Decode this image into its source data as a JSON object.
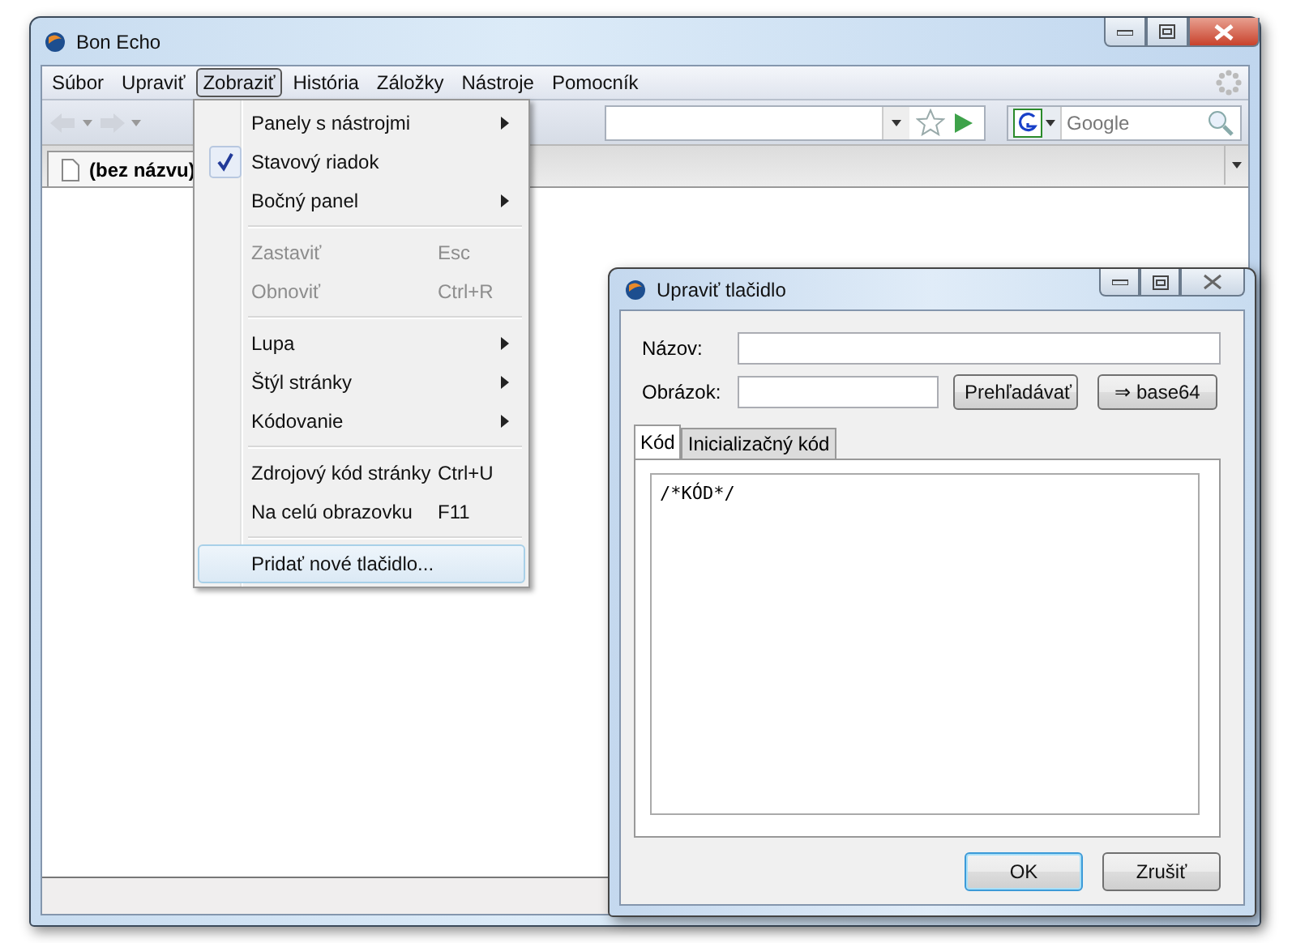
{
  "window": {
    "title": "Bon Echo"
  },
  "menubar": [
    {
      "label": "Súbor",
      "selected": false
    },
    {
      "label": "Upraviť",
      "selected": false
    },
    {
      "label": "Zobraziť",
      "selected": true
    },
    {
      "label": "História",
      "selected": false
    },
    {
      "label": "Záložky",
      "selected": false
    },
    {
      "label": "Nástroje",
      "selected": false
    },
    {
      "label": "Pomocník",
      "selected": false
    }
  ],
  "search": {
    "placeholder": "Google"
  },
  "tabs": [
    {
      "label": "(bez názvu)",
      "selected": true
    }
  ],
  "menu": [
    {
      "kind": "item",
      "label": "Panely s nástrojmi",
      "submenu": true,
      "checked": false,
      "disabled": false,
      "selected": false
    },
    {
      "kind": "item",
      "label": "Stavový riadok",
      "submenu": false,
      "checked": true,
      "disabled": false,
      "selected": false
    },
    {
      "kind": "item",
      "label": "Bočný panel",
      "submenu": true,
      "checked": false,
      "disabled": false,
      "selected": false
    },
    {
      "kind": "separator"
    },
    {
      "kind": "item",
      "label": "Zastaviť",
      "shortcut": "Esc",
      "submenu": false,
      "checked": false,
      "disabled": true,
      "selected": false
    },
    {
      "kind": "item",
      "label": "Obnoviť",
      "shortcut": "Ctrl+R",
      "submenu": false,
      "checked": false,
      "disabled": true,
      "selected": false
    },
    {
      "kind": "separator"
    },
    {
      "kind": "item",
      "label": "Lupa",
      "submenu": true,
      "checked": false,
      "disabled": false,
      "selected": false
    },
    {
      "kind": "item",
      "label": "Štýl stránky",
      "submenu": true,
      "checked": false,
      "disabled": false,
      "selected": false
    },
    {
      "kind": "item",
      "label": "Kódovanie",
      "submenu": true,
      "checked": false,
      "disabled": false,
      "selected": false
    },
    {
      "kind": "separator"
    },
    {
      "kind": "item",
      "label": "Zdrojový kód stránky",
      "shortcut": "Ctrl+U",
      "submenu": false,
      "checked": false,
      "disabled": false,
      "selected": false
    },
    {
      "kind": "item",
      "label": "Na celú obrazovku",
      "shortcut": "F11",
      "submenu": false,
      "checked": false,
      "disabled": false,
      "selected": false
    },
    {
      "kind": "separator"
    },
    {
      "kind": "item",
      "label": "Pridať nové tlačidlo...",
      "submenu": false,
      "checked": false,
      "disabled": false,
      "selected": true
    }
  ],
  "dialog": {
    "title": "Upraviť tlačidlo",
    "name_label": "Názov:",
    "image_label": "Obrázok:",
    "browse_button": "Prehľadávať",
    "base64_button": "⇒ base64",
    "tabs": [
      {
        "label": "Kód",
        "selected": true
      },
      {
        "label": "Inicializačný kód",
        "selected": false
      }
    ],
    "code": "/*KÓD*/",
    "buttons": [
      {
        "label": "OK",
        "default": true
      },
      {
        "label": "Zrušiť",
        "default": false
      }
    ]
  }
}
